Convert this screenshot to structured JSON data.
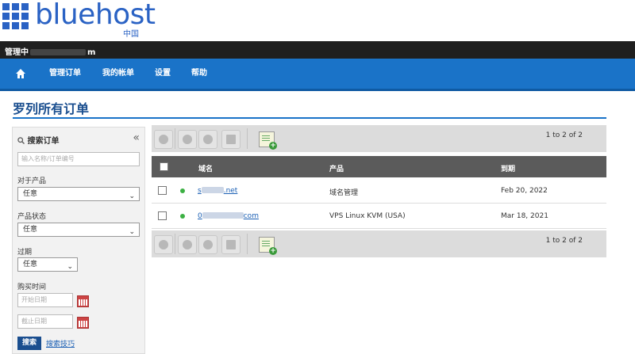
{
  "brand": {
    "name": "bluehost",
    "sub": "中国"
  },
  "topbar": {
    "account_prefix": "管理中",
    "account_suffix": "m"
  },
  "nav": {
    "items": [
      "管理订单",
      "我的帐单",
      "设置",
      "帮助"
    ]
  },
  "page": {
    "title": "罗列所有订单"
  },
  "sidebar": {
    "heading": "搜索订单",
    "search_placeholder": "输入名称/订单编号",
    "for_product_label": "对于产品",
    "for_product_value": "任意",
    "status_label": "产品状态",
    "status_value": "任意",
    "expired_label": "过期",
    "expired_value": "任意",
    "purchase_time_label": "购买时间",
    "start_date_placeholder": "开始日期",
    "end_date_placeholder": "截止日期",
    "search_button": "搜索",
    "search_tips": "搜索技巧"
  },
  "table": {
    "pager": "1 to 2 of 2",
    "columns": [
      "域名",
      "产品",
      "到期"
    ],
    "rows": [
      {
        "domain_start": "s",
        "domain_end": ".net",
        "product": "域名管理",
        "expiry": "Feb 20, 2022"
      },
      {
        "domain_start": "0",
        "domain_end": "com",
        "product": "VPS Linux KVM (USA)",
        "expiry": "Mar 18, 2021"
      }
    ]
  },
  "colors": {
    "nav_blue": "#1a73c8",
    "brand_blue": "#2a62c4",
    "header_dark": "#1f1f1f",
    "table_head": "#5b5b5b"
  },
  "icons": [
    "home-icon",
    "search-icon",
    "collapse-icon",
    "calendar-icon",
    "refresh-icon",
    "add-order-icon"
  ]
}
